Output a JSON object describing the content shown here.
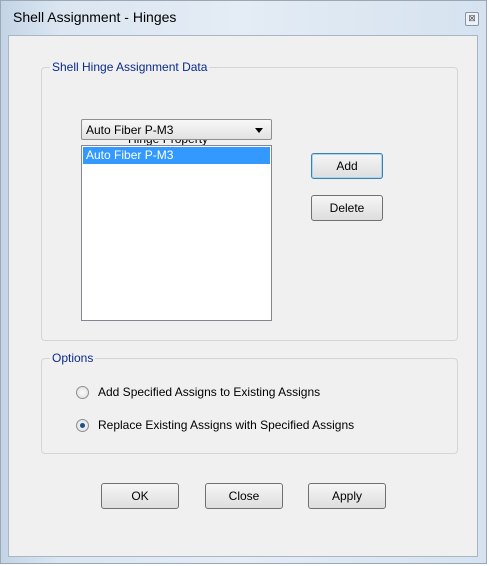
{
  "window": {
    "title": "Shell Assignment - Hinges",
    "close_glyph": "⊠"
  },
  "hinge_group": {
    "title": "Shell Hinge Assignment Data",
    "property_label": "Hinge Property",
    "combo_value": "Auto Fiber P-M3",
    "list_items": [
      {
        "label": "Auto Fiber P-M3",
        "selected": true
      }
    ],
    "add_label": "Add",
    "delete_label": "Delete"
  },
  "options_group": {
    "title": "Options",
    "radio_add_label": "Add Specified Assigns to Existing Assigns",
    "radio_replace_label": "Replace Existing Assigns with Specified Assigns",
    "selected_option": "replace"
  },
  "buttons": {
    "ok": "OK",
    "close": "Close",
    "apply": "Apply"
  }
}
